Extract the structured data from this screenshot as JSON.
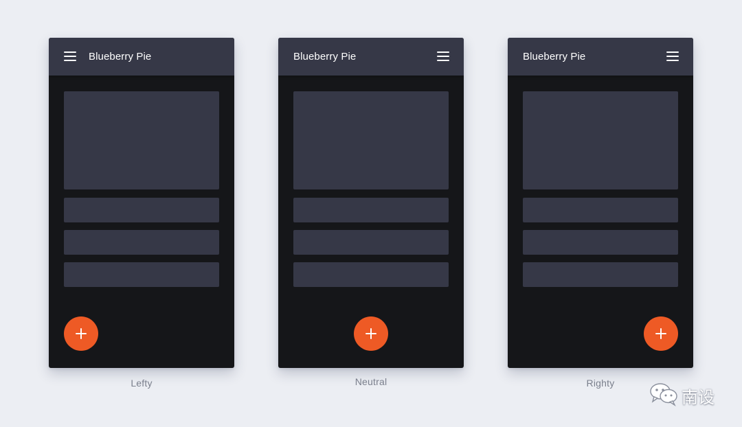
{
  "colors": {
    "background": "#eceef3",
    "phone_body": "#151619",
    "app_bar": "#363847",
    "placeholder_block": "#363847",
    "fab": "#ee5a25",
    "caption_text": "#7a7f8c"
  },
  "phones": [
    {
      "app_title": "Blueberry Pie",
      "menu_icon": "hamburger-menu-icon",
      "menu_position": "left",
      "fab_icon": "plus-icon",
      "fab_position": "left",
      "caption": "Lefty"
    },
    {
      "app_title": "Blueberry Pie",
      "menu_icon": "hamburger-menu-icon",
      "menu_position": "right",
      "fab_icon": "plus-icon",
      "fab_position": "center",
      "caption": "Neutral"
    },
    {
      "app_title": "Blueberry Pie",
      "menu_icon": "hamburger-menu-icon",
      "menu_position": "right",
      "fab_icon": "plus-icon",
      "fab_position": "right",
      "caption": "Righty"
    }
  ],
  "watermark": {
    "icon": "wechat-icon",
    "text": "南设"
  }
}
